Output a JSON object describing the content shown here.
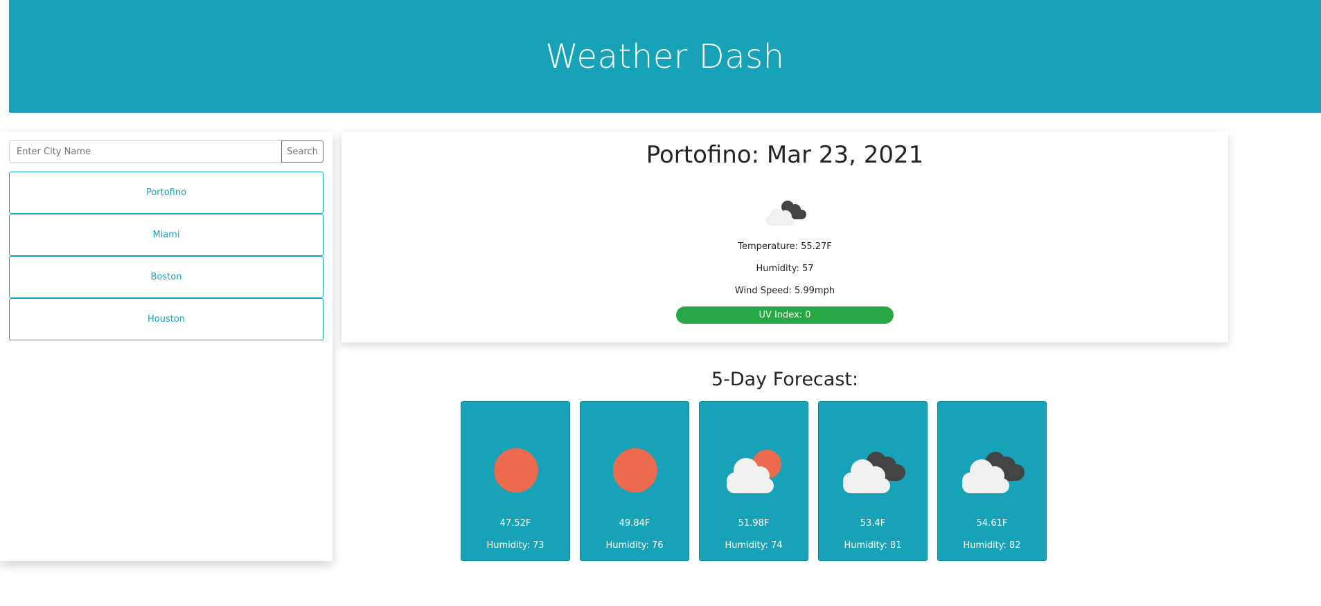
{
  "header": {
    "title": "Weather Dash"
  },
  "search": {
    "placeholder": "Enter City Name",
    "value": "",
    "button_label": "Search"
  },
  "cities": [
    {
      "label": "Portofino"
    },
    {
      "label": "Miami"
    },
    {
      "label": "Boston"
    },
    {
      "label": "Houston"
    }
  ],
  "current": {
    "title": "Portofino: Mar 23, 2021",
    "icon": "broken-clouds-icon",
    "temperature": "Temperature: 55.27F",
    "humidity": "Humidity: 57",
    "wind": "Wind Speed: 5.99mph",
    "uv": "UV Index: 0",
    "uv_color": "#28a745"
  },
  "forecast": {
    "title": "5-Day Forecast:",
    "days": [
      {
        "icon": "clear-sky-icon",
        "temp": "47.52F",
        "humidity": "Humidity: 73"
      },
      {
        "icon": "clear-sky-icon",
        "temp": "49.84F",
        "humidity": "Humidity: 76"
      },
      {
        "icon": "few-clouds-icon",
        "temp": "51.98F",
        "humidity": "Humidity: 74"
      },
      {
        "icon": "broken-clouds-icon",
        "temp": "53.4F",
        "humidity": "Humidity: 81"
      },
      {
        "icon": "broken-clouds-icon",
        "temp": "54.61F",
        "humidity": "Humidity: 82"
      }
    ]
  },
  "colors": {
    "accent": "#17a2b8",
    "sun": "#ec6b4e",
    "dark_cloud": "#444444",
    "light_cloud": "#f1f1f1"
  }
}
